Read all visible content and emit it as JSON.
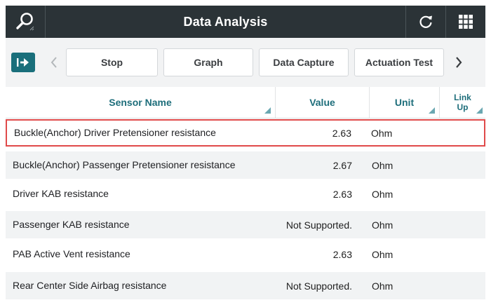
{
  "header": {
    "title": "Data Analysis"
  },
  "toolbar": {
    "buttons": [
      {
        "label": "Stop"
      },
      {
        "label": "Graph"
      },
      {
        "label": "Data Capture"
      },
      {
        "label": "Actuation Test"
      }
    ]
  },
  "table": {
    "columns": [
      "Sensor Name",
      "Value",
      "Unit",
      "Link",
      "Up"
    ],
    "rows": [
      {
        "name": "Buckle(Anchor) Driver Pretensioner resistance",
        "value": "2.63",
        "unit": "Ohm"
      },
      {
        "name": "Buckle(Anchor) Passenger Pretensioner resistance",
        "value": "2.67",
        "unit": "Ohm"
      },
      {
        "name": "Driver KAB resistance",
        "value": "2.63",
        "unit": "Ohm"
      },
      {
        "name": "Passenger KAB resistance",
        "value": "Not Supported.",
        "unit": "Ohm"
      },
      {
        "name": "PAB Active Vent resistance",
        "value": "2.63",
        "unit": "Ohm"
      },
      {
        "name": "Rear Center Side Airbag resistance",
        "value": "Not Supported.",
        "unit": "Ohm"
      }
    ]
  },
  "colors": {
    "titlebar": "#2b3337",
    "accent": "#1a6f7b",
    "header_text": "#1e6e7b",
    "selection": "#e04a4a"
  },
  "icons": [
    "search-icon",
    "refresh-icon",
    "grid-menu-icon",
    "exit-icon",
    "chevron-left-icon",
    "chevron-right-icon"
  ]
}
